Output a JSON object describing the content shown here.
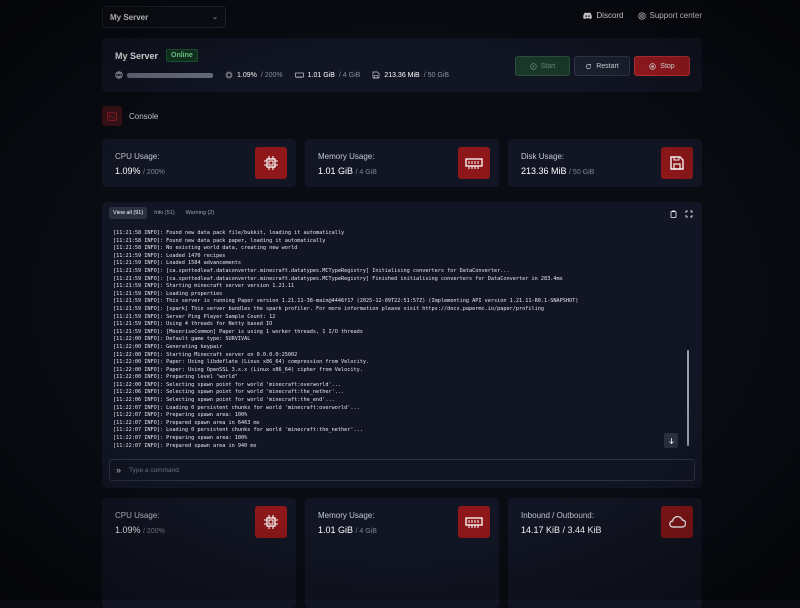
{
  "topbar": {
    "server_select": "My Server",
    "discord_label": "Discord",
    "support_label": "Support center"
  },
  "server": {
    "name": "My Server",
    "status": "Online",
    "cpu": "1.09%",
    "cpu_limit": "/ 200%",
    "memory": "1.01 GiB",
    "memory_limit": "/ 4 GiB",
    "disk": "213.36 MiB",
    "disk_limit": "/ 50 GiB"
  },
  "buttons": {
    "start": "Start",
    "restart": "Restart",
    "stop": "Stop"
  },
  "console_tab": "Console",
  "cards_top": [
    {
      "label": "CPU Usage:",
      "value": "1.09%",
      "limit": "/ 200%",
      "icon": "cpu-icon"
    },
    {
      "label": "Memory Usage:",
      "value": "1.01 GiB",
      "limit": "/ 4 GiB",
      "icon": "memory-icon"
    },
    {
      "label": "Disk Usage:",
      "value": "213.36 MiB",
      "limit": "/ 50 GiB",
      "icon": "save-icon"
    }
  ],
  "console": {
    "tabs": [
      "View all (91)",
      "Info (51)",
      "Warning (2)"
    ],
    "lines": [
      "[11:21:58 INFO]: Found new data pack file/bukkit, loading it automatically",
      "[11:21:58 INFO]: Found new data pack paper, loading it automatically",
      "[11:21:58 INFO]: No existing world data, creating new world",
      "[11:21:59 INFO]: Loaded 1470 recipes",
      "[11:21:59 INFO]: Loaded 1584 advancements",
      "[11:21:59 INFO]: [ca.spottedleaf.dataconverter.minecraft.datatypes.MCTypeRegistry] Initialising converters for DataConverter...",
      "[11:21:59 INFO]: [ca.spottedleaf.dataconverter.minecraft.datatypes.MCTypeRegistry] Finished initialising converters for DataConverter in 283.4ms",
      "[11:21:59 INFO]: Starting minecraft server version 1.21.11",
      "[11:21:59 INFO]: Loading properties",
      "[11:21:59 INFO]: This server is running Paper version 1.21.11-38-main@4446f17 (2025-12-09T22:51:57Z) (Implementing API version 1.21.11-R0.1-SNAPSHOT)",
      "[11:21:59 INFO]: [spark] This server bundles the spark profiler. For more information please visit https://docs.papermc.io/paper/profiling",
      "[11:21:59 INFO]: Server Ping Player Sample Count: 12",
      "[11:21:59 INFO]: Using 4 threads for Netty based IO",
      "[11:21:59 INFO]: [MoonriseCommon] Paper is using 1 worker threads, 1 I/O threads",
      "[11:22:00 INFO]: Default game type: SURVIVAL",
      "[11:22:00 INFO]: Generating keypair",
      "[11:22:00 INFO]: Starting Minecraft server on 0.0.0.0:25002",
      "[11:22:00 INFO]: Paper: Using libdeflate (Linux x86_64) compression from Velocity.",
      "[11:22:00 INFO]: Paper: Using OpenSSL 3.x.x (Linux x86_64) cipher from Velocity.",
      "[11:22:00 INFO]: Preparing level \"world\"",
      "[11:22:00 INFO]: Selecting spawn point for world 'minecraft:overworld'...",
      "[11:22:06 INFO]: Selecting spawn point for world 'minecraft:the_nether'...",
      "[11:22:06 INFO]: Selecting spawn point for world 'minecraft:the_end'...",
      "[11:22:07 INFO]: Loading 0 persistent chunks for world 'minecraft:overworld'...",
      "[11:22:07 INFO]: Preparing spawn area: 100%",
      "[11:22:07 INFO]: Prepared spawn area in 6463 ms",
      "[11:22:07 INFO]: Loading 0 persistent chunks for world 'minecraft:the_nether'...",
      "[11:22:07 INFO]: Preparing spawn area: 100%",
      "[11:22:07 INFO]: Prepared spawn area in 940 ms"
    ],
    "command_placeholder": "Type a command"
  },
  "cards_bottom": [
    {
      "label": "CPU Usage:",
      "value": "1.09%",
      "limit": "/ 200%",
      "icon": "cpu-icon"
    },
    {
      "label": "Memory Usage:",
      "value": "1.01 GiB",
      "limit": "/ 4 GiB",
      "icon": "memory-icon"
    },
    {
      "label": "Inbound / Outbound:",
      "value": "14.17 KiB / 3.44 KiB",
      "limit": "",
      "icon": "cloud-icon"
    }
  ],
  "colors": {
    "accent": "#8d1719",
    "online": "#7ee29e",
    "background": "#0a0c13",
    "panel": "#121624"
  }
}
